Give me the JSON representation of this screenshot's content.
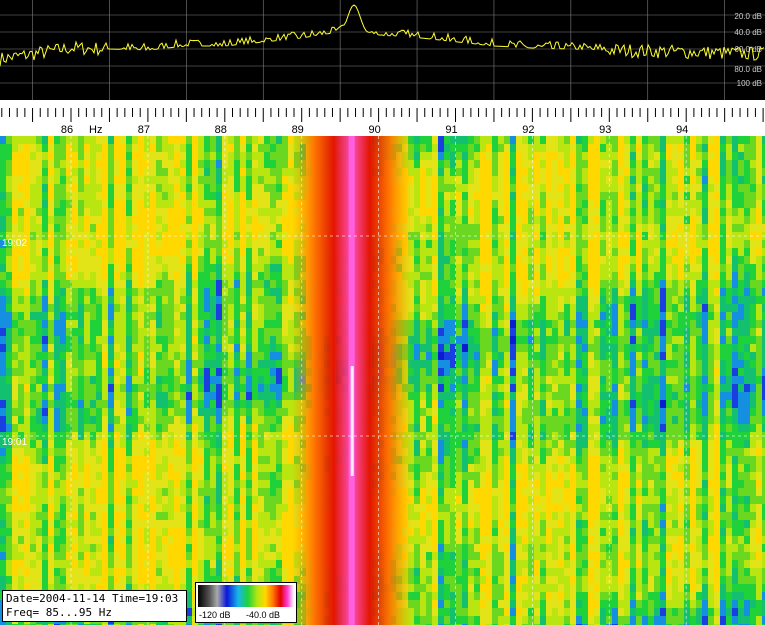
{
  "chart_data": [
    {
      "type": "line",
      "x_range": [
        85,
        95
      ],
      "y_ticks": [
        "20.0 dB",
        "40.0 dB",
        "60.0 dB",
        "80.0 dB",
        "100 dB"
      ],
      "ylim": [
        -110,
        -10
      ],
      "series": [
        {
          "color": "#ffff30",
          "peaks": [
            {
              "x": 89.68,
              "y": -15
            },
            {
              "x": 89.55,
              "y": -35
            },
            {
              "x": 89.85,
              "y": -42
            }
          ],
          "baseline": [
            {
              "x": 85.0,
              "y": -70
            },
            {
              "x": 86.0,
              "y": -58
            },
            {
              "x": 87.0,
              "y": -60
            },
            {
              "x": 87.5,
              "y": -56
            },
            {
              "x": 88.0,
              "y": -56
            },
            {
              "x": 88.5,
              "y": -52
            },
            {
              "x": 89.0,
              "y": -48
            },
            {
              "x": 89.3,
              "y": -44
            },
            {
              "x": 90.3,
              "y": -46
            },
            {
              "x": 90.8,
              "y": -50
            },
            {
              "x": 91.5,
              "y": -56
            },
            {
              "x": 92.0,
              "y": -58
            },
            {
              "x": 93.0,
              "y": -60
            },
            {
              "x": 94.0,
              "y": -62
            },
            {
              "x": 95.0,
              "y": -64
            }
          ]
        }
      ],
      "grid": true
    },
    {
      "type": "heatmap",
      "x_ticks": [
        "86",
        "87",
        "88",
        "89",
        "90",
        "91",
        "92",
        "93",
        "94"
      ],
      "x_unit": "Hz",
      "y_labels": [
        "19:02",
        "19:01"
      ],
      "signal": {
        "x": 89.65,
        "y_top": "19:03",
        "width_hz": 0.8
      },
      "colorbar": {
        "min_label": "-120 dB",
        "max_label": "-40.0 dB"
      }
    }
  ],
  "info": {
    "line1": "Date=2004-11-14 Time=19:03",
    "line2": "Freq= 85...95 Hz"
  },
  "colors": {
    "trace": "#ffff30",
    "grid": "#808080",
    "spectrum_bg": "#000000",
    "ruler_bg": "#ffffff"
  }
}
